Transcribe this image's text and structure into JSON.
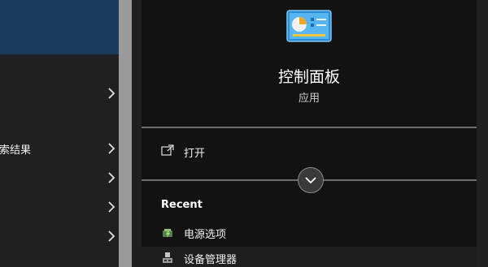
{
  "left_list": {
    "items": [
      {
        "label": ""
      },
      {
        "label": ""
      },
      {
        "label": "索结果"
      },
      {
        "label": ""
      },
      {
        "label": ""
      },
      {
        "label": ""
      }
    ]
  },
  "details": {
    "app_name": "控制面板",
    "app_type": "应用",
    "icon": "control-panel-icon",
    "actions": [
      {
        "label": "打开",
        "icon": "open-icon"
      }
    ],
    "recent_heading": "Recent",
    "recent_items": [
      {
        "label": "电源选项",
        "icon": "power-options-icon"
      },
      {
        "label": "设备管理器",
        "icon": "device-manager-icon"
      }
    ]
  },
  "colors": {
    "selected_bg": "#1a3b5b",
    "pane_bg": "#121212",
    "list_bg": "#202020",
    "accent": "#3a9ad9"
  }
}
